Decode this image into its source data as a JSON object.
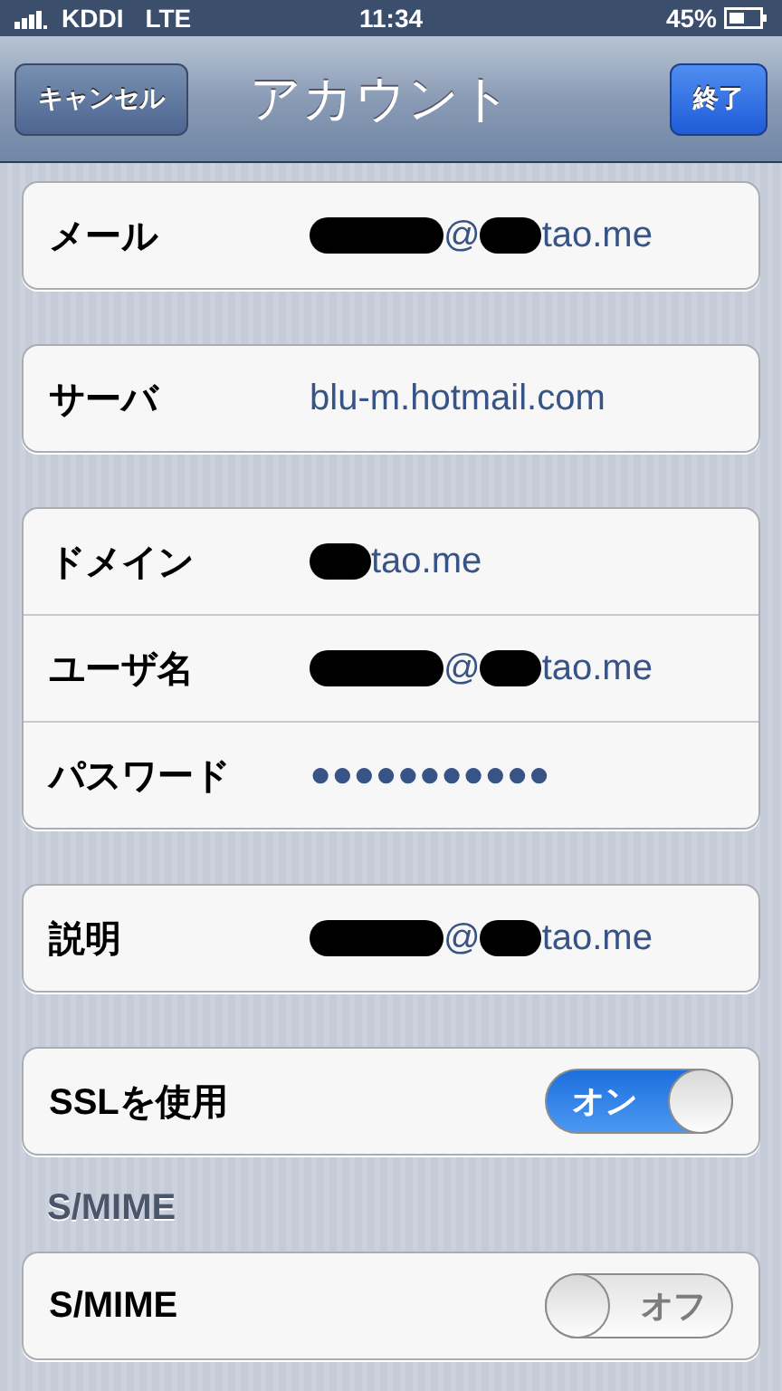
{
  "status_bar": {
    "carrier": "KDDI",
    "network": "LTE",
    "time": "11:34",
    "battery": "45%"
  },
  "nav_bar": {
    "title": "アカウント",
    "left_button": "キャンセル",
    "right_button": "終了"
  },
  "groups": [
    {
      "rows": [
        {
          "kind": "value",
          "label": "メール",
          "parts": [
            {
              "kind": "redacted"
            },
            {
              "kind": "text",
              "text": "@"
            },
            {
              "kind": "redacted"
            },
            {
              "kind": "text",
              "text": "tao.me"
            }
          ]
        }
      ]
    },
    {
      "rows": [
        {
          "kind": "value",
          "label": "サーバ",
          "parts": [
            {
              "kind": "text",
              "text": "blu-m.hotmail.com"
            }
          ]
        }
      ]
    },
    {
      "rows": [
        {
          "kind": "value",
          "label": "ドメイン",
          "parts": [
            {
              "kind": "redacted"
            },
            {
              "kind": "text",
              "text": "tao.me"
            }
          ]
        },
        {
          "kind": "value",
          "label": "ユーザ名",
          "parts": [
            {
              "kind": "redacted"
            },
            {
              "kind": "text",
              "text": "@"
            },
            {
              "kind": "redacted"
            },
            {
              "kind": "text",
              "text": "tao.me"
            }
          ]
        },
        {
          "kind": "value",
          "label": "パスワード",
          "parts": [
            {
              "kind": "text",
              "text": "●●●●●●●●●●●"
            }
          ]
        }
      ]
    },
    {
      "rows": [
        {
          "kind": "value",
          "label": "説明",
          "parts": [
            {
              "kind": "redacted"
            },
            {
              "kind": "text",
              "text": "@"
            },
            {
              "kind": "redacted"
            },
            {
              "kind": "text",
              "text": "tao.me"
            }
          ]
        }
      ]
    },
    {
      "rows": [
        {
          "kind": "switch",
          "label": "SSLを使用",
          "on": true,
          "switch_text": "オン"
        }
      ]
    },
    {
      "header": "S/MIME",
      "rows": [
        {
          "kind": "switch",
          "label": "S/MIME",
          "on": false,
          "switch_text": "オフ"
        }
      ]
    }
  ]
}
